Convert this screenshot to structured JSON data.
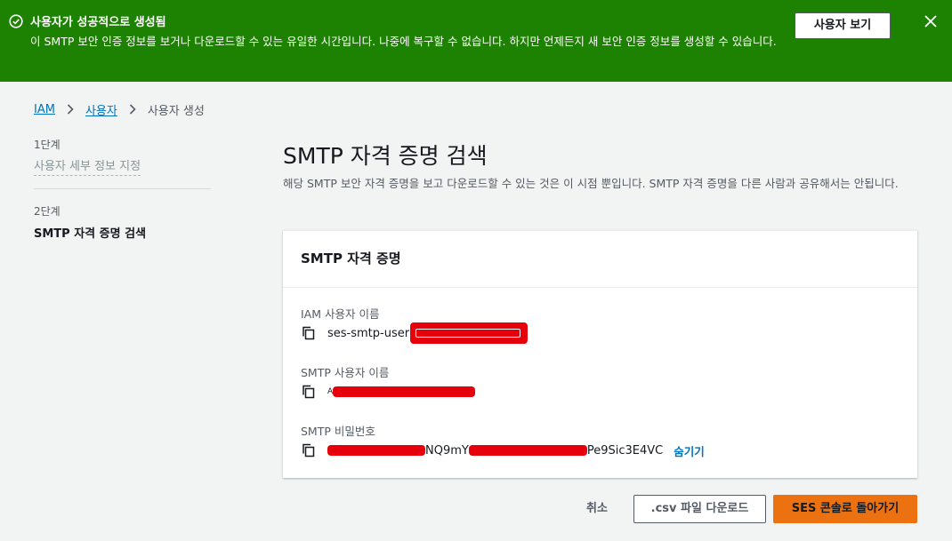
{
  "banner": {
    "title": "사용자가 성공적으로 생성됨",
    "message": "이 SMTP 보안 인증 정보를 보거나 다운로드할 수 있는 유일한 시간입니다. 나중에 복구할 수 없습니다. 하지만 언제든지 새 보안 인증 정보를 생성할 수 있습니다.",
    "view_user_button": "사용자 보기",
    "color": "#1d8102"
  },
  "breadcrumb": {
    "items": [
      "IAM",
      "사용자"
    ],
    "current": "사용자 생성"
  },
  "steps": [
    {
      "label": "1단계",
      "name": "사용자 세부 정보 지정"
    },
    {
      "label": "2단계",
      "name": "SMTP 자격 증명 검색"
    }
  ],
  "main": {
    "title": "SMTP 자격 증명 검색",
    "description": "해당 SMTP 보안 자격 증명을 보고 다운로드할 수 있는 것은 이 시점 뿐입니다. SMTP 자격 증명을 다른 사람과 공유해서는 안됩니다."
  },
  "panel": {
    "title": "SMTP 자격 증명",
    "iam_user_label": "IAM 사용자 이름",
    "iam_user_value": "ses-smtp-user",
    "smtp_user_label": "SMTP 사용자 이름",
    "smtp_user_value": "A",
    "smtp_password_label": "SMTP 비밀번호",
    "smtp_password_mid": "NQ9mY",
    "smtp_password_end": "Pe9Sic3E4VC",
    "hide_link": "숨기기"
  },
  "footer": {
    "cancel": "취소",
    "download_csv": ".csv 파일 다운로드",
    "return_ses": "SES 콘솔로 돌아가기"
  },
  "colors": {
    "accent": "#ec7211",
    "link": "#0073bb",
    "redaction": "#e5000c"
  }
}
